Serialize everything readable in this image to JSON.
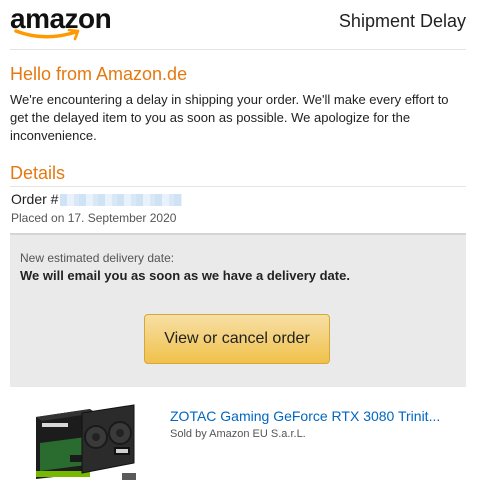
{
  "header": {
    "brand": "amazon",
    "title": "Shipment Delay"
  },
  "greeting": {
    "heading": "Hello from Amazon.de",
    "body": "We're encountering a delay in shipping your order. We'll make every effort to get the delayed item to you as soon as possible. We apologize for the inconvenience."
  },
  "details": {
    "heading": "Details",
    "order_label": "Order #",
    "placed": "Placed on 17. September 2020"
  },
  "delivery": {
    "label": "New estimated delivery date:",
    "value": "We will email you as soon as we have a delivery date.",
    "button_label": "View or cancel order"
  },
  "product": {
    "title": "ZOTAC Gaming GeForce RTX 3080 Trinit...",
    "seller": "Sold by Amazon EU S.a.r.L.",
    "image_icon": "graphics-card-product-image"
  },
  "colors": {
    "accent": "#e47911",
    "link": "#0066c0",
    "button": "#f0c14b"
  }
}
